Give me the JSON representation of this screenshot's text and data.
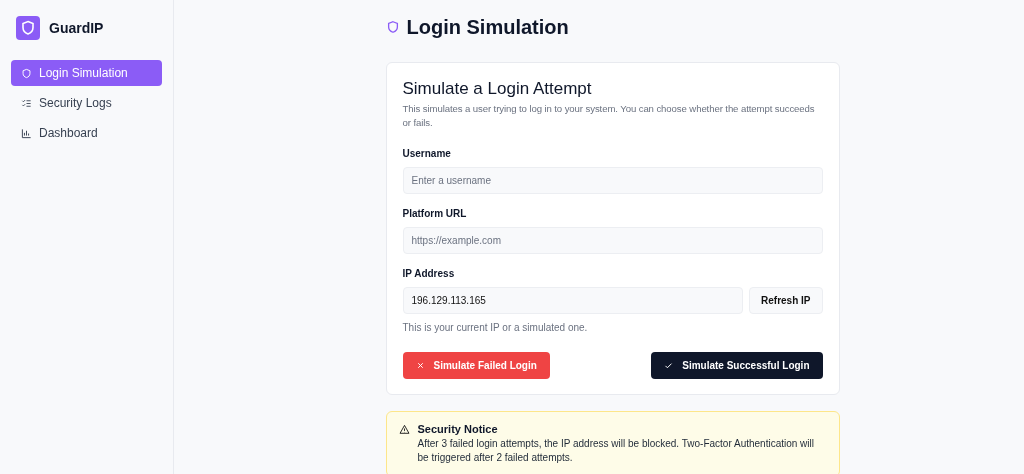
{
  "brand": {
    "name": "GuardIP"
  },
  "sidebar": {
    "items": [
      {
        "label": "Login Simulation",
        "kind": "shield",
        "selected": true
      },
      {
        "label": "Security Logs",
        "kind": "list",
        "selected": false
      },
      {
        "label": "Dashboard",
        "kind": "chart",
        "selected": false
      }
    ]
  },
  "page_title": "Login Simulation",
  "card": {
    "title": "Simulate a Login Attempt",
    "description": "This simulates a user trying to log in to your system. You can choose whether the attempt succeeds or fails.",
    "fields": [
      {
        "label": "Username",
        "placeholder": "Enter a username"
      },
      {
        "label": "Platform URL",
        "placeholder": "https://example.com"
      },
      {
        "label": "IP Address",
        "value": "196.129.113.165",
        "button": "Refresh IP",
        "hint": "This is your current IP or a simulated one."
      }
    ],
    "actions": [
      {
        "label": "Simulate Failed Login",
        "kind": "danger"
      },
      {
        "label": "Simulate Successful Login",
        "kind": "primary"
      }
    ]
  },
  "notice": {
    "title": "Security Notice",
    "text": "After 3 failed login attempts, the IP address will be blocked. Two-Factor Authentication will be triggered after 2 failed attempts."
  }
}
